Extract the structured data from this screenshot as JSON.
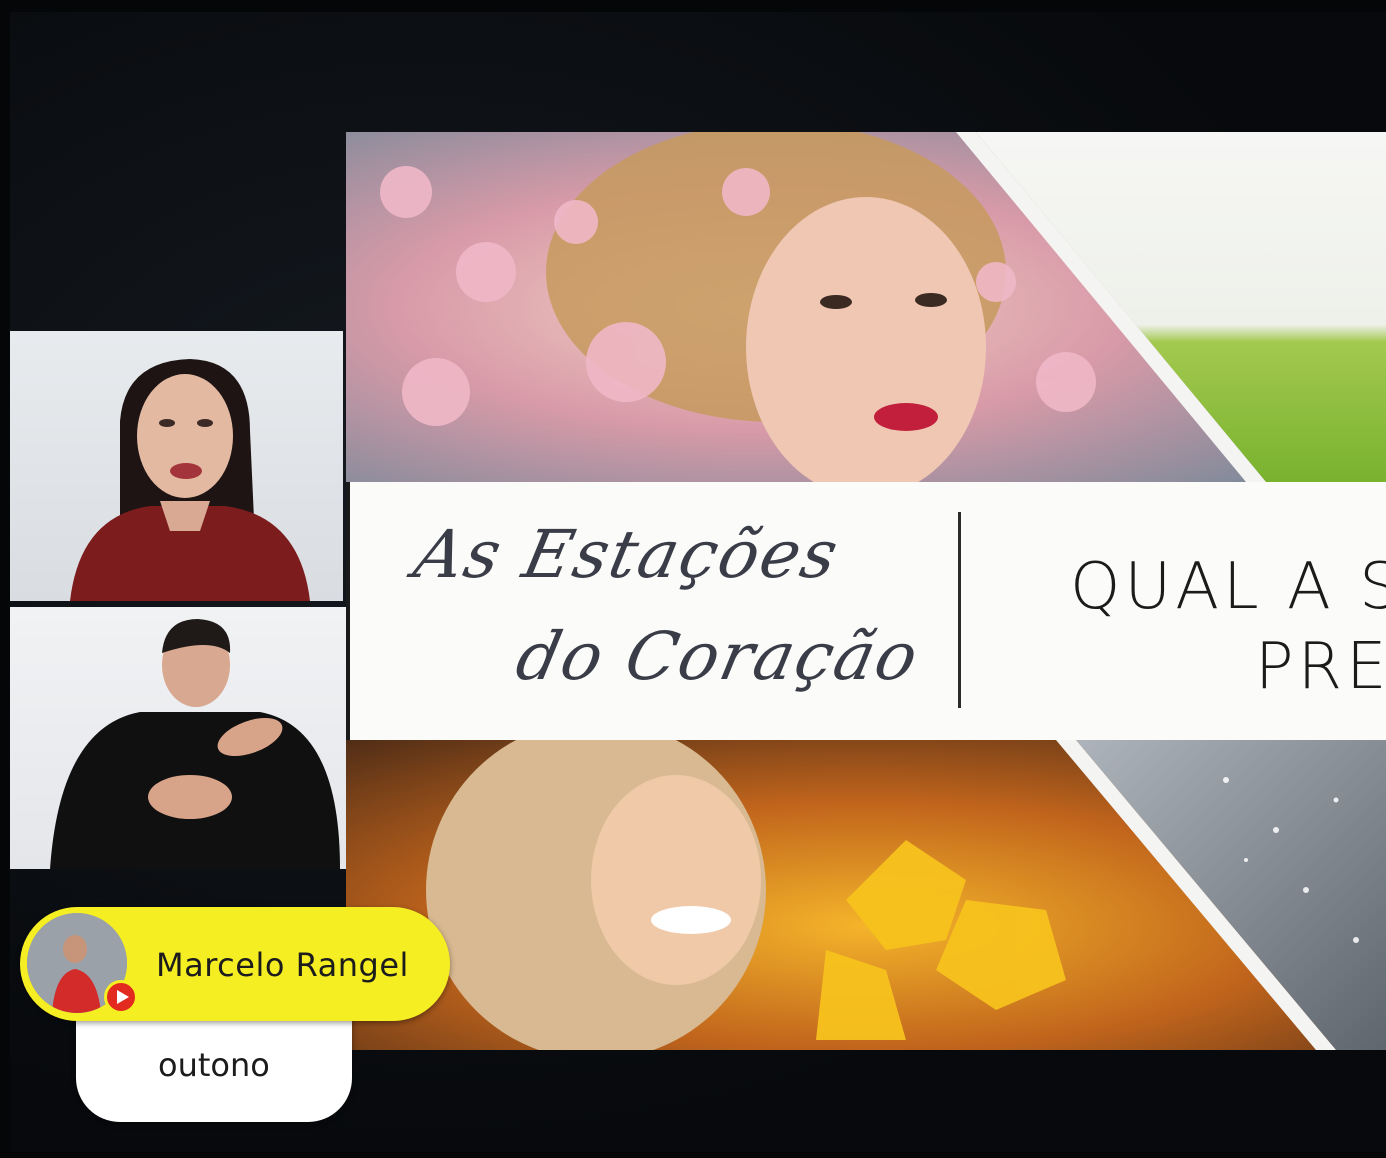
{
  "slide": {
    "title_line1": "As Estações",
    "title_line2": "do Coração",
    "question_line1": "QUAL A S",
    "question_line2": "PRE"
  },
  "participants": {
    "host": {
      "role": "presenter-camera"
    },
    "interpreter": {
      "role": "sign-language-interpreter-camera"
    }
  },
  "chat": {
    "author": "Marcelo Rangel",
    "message": "outono",
    "source_icon": "youtube-icon"
  },
  "colors": {
    "chat_pill": "#f5ee22",
    "youtube_red": "#e32a1f",
    "screen_bg": "#050608"
  }
}
